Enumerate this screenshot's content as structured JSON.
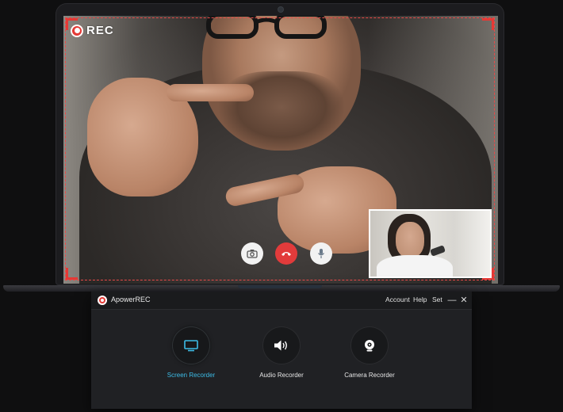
{
  "overlay": {
    "rec_label": "REC"
  },
  "app": {
    "name": "ApowerREC",
    "menu": {
      "account": "Account",
      "help": "Help",
      "set": "Set"
    },
    "window_controls": {
      "minimize": "—",
      "close": "✕"
    },
    "tools": [
      {
        "label": "Screen Recorder",
        "icon": "monitor-icon",
        "active": true
      },
      {
        "label": "Audio Recorder",
        "icon": "speaker-icon",
        "active": false
      },
      {
        "label": "Camera Recorder",
        "icon": "webcam-icon",
        "active": false
      }
    ]
  },
  "colors": {
    "accent": "#3dbde8",
    "record_red": "#e53935",
    "window_bg": "#202124"
  }
}
